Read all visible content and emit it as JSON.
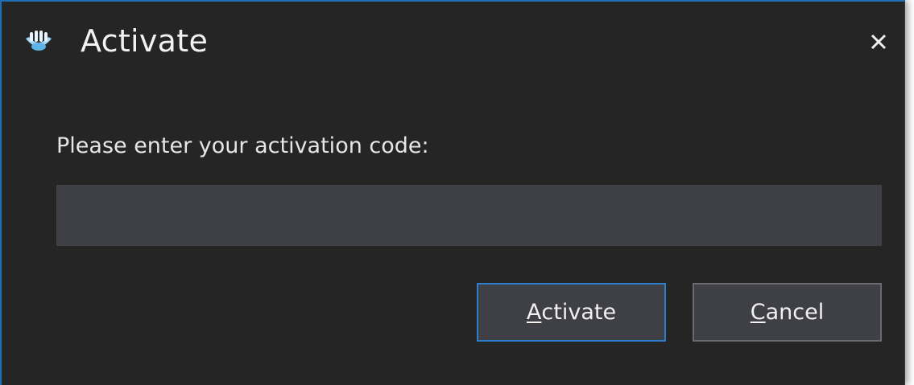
{
  "dialog": {
    "title": "Activate",
    "app_icon": "app-logo-icon",
    "close_icon": "close-icon",
    "close_glyph": "✕"
  },
  "form": {
    "prompt": "Please enter your activation code:",
    "code_value": "",
    "code_placeholder": ""
  },
  "buttons": {
    "activate": {
      "mnemonic": "A",
      "rest": "ctivate"
    },
    "cancel": {
      "mnemonic": "C",
      "rest": "ancel"
    }
  },
  "colors": {
    "background": "#252526",
    "input": "#3f3f46",
    "accent": "#2d7fce",
    "text": "#f1f1f1"
  }
}
